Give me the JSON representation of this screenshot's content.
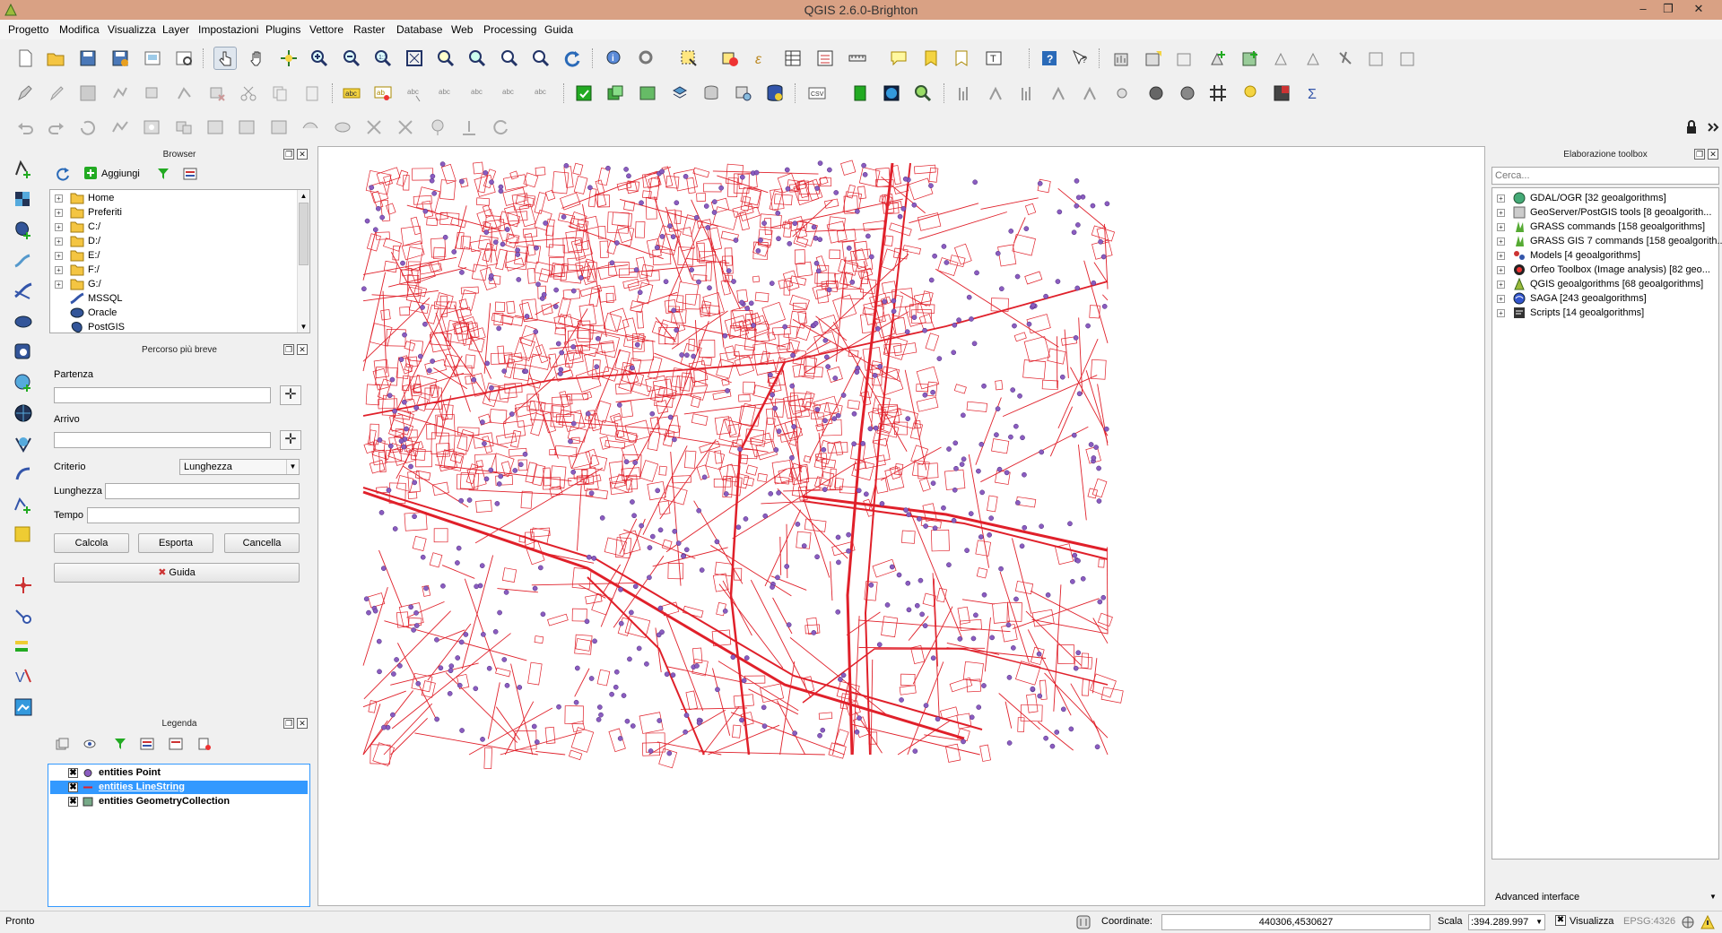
{
  "window": {
    "title": "QGIS 2.6.0-Brighton",
    "minimize": "–",
    "restore": "❐",
    "close": "✕"
  },
  "menu": [
    "Progetto",
    "Modifica",
    "Visualizza",
    "Layer",
    "Impostazioni",
    "Plugins",
    "Vettore",
    "Raster",
    "Database",
    "Web",
    "Processing",
    "Guida"
  ],
  "browser": {
    "title": "Browser",
    "add_label": "Aggiungi",
    "items": [
      {
        "label": "Home",
        "icon": "folder"
      },
      {
        "label": "Preferiti",
        "icon": "folder"
      },
      {
        "label": "C:/",
        "icon": "folder"
      },
      {
        "label": "D:/",
        "icon": "folder"
      },
      {
        "label": "E:/",
        "icon": "folder"
      },
      {
        "label": "F:/",
        "icon": "folder"
      },
      {
        "label": "G:/",
        "icon": "folder"
      },
      {
        "label": "MSSQL",
        "icon": "mssql"
      },
      {
        "label": "Oracle",
        "icon": "oracle"
      },
      {
        "label": "PostGIS",
        "icon": "postgis"
      }
    ]
  },
  "shortest_path": {
    "title": "Percorso più breve",
    "start_label": "Partenza",
    "start_value": "",
    "end_label": "Arrivo",
    "end_value": "",
    "criterion_label": "Criterio",
    "criterion_value": "Lunghezza",
    "length_label": "Lunghezza",
    "length_value": "",
    "time_label": "Tempo",
    "time_value": "",
    "calc_button": "Calcola",
    "export_button": "Esporta",
    "cancel_button": "Cancella",
    "help_button": "Guida"
  },
  "legend": {
    "title": "Legenda",
    "layers": [
      {
        "label": "entities Point",
        "checked": true,
        "symbol": "point",
        "selected": false
      },
      {
        "label": "entities LineString",
        "checked": true,
        "symbol": "line",
        "selected": true
      },
      {
        "label": "entities GeometryCollection",
        "checked": true,
        "symbol": "collection",
        "selected": false
      }
    ]
  },
  "toolbox": {
    "title": "Elaborazione toolbox",
    "search_placeholder": "Cerca...",
    "items": [
      {
        "label": "GDAL/OGR [32 geoalgorithms]",
        "icon": "gdal"
      },
      {
        "label": "GeoServer/PostGIS tools [8 geoalgorith...",
        "icon": "geoserver"
      },
      {
        "label": "GRASS commands [158 geoalgorithms]",
        "icon": "grass"
      },
      {
        "label": "GRASS GIS 7 commands [158 geoalgorith...",
        "icon": "grass"
      },
      {
        "label": "Models [4 geoalgorithms]",
        "icon": "models"
      },
      {
        "label": "Orfeo Toolbox (Image analysis) [82 geo...",
        "icon": "orfeo"
      },
      {
        "label": "QGIS geoalgorithms [68 geoalgorithms]",
        "icon": "qgis"
      },
      {
        "label": "SAGA [243 geoalgorithms]",
        "icon": "saga"
      },
      {
        "label": "Scripts [14 geoalgorithms]",
        "icon": "scripts"
      }
    ],
    "advanced_interface": "Advanced interface"
  },
  "status": {
    "message": "Pronto",
    "coordinate_label": "Coordinate:",
    "coordinate_value": "440306,4530627",
    "scale_label": "Scala",
    "scale_value": ":394.289.997",
    "render_label": "Visualizza",
    "crs": "EPSG:4326"
  },
  "colors": {
    "map_lines": "#e0202a",
    "map_points": "#8a5cc0",
    "selection": "#3399ff"
  }
}
